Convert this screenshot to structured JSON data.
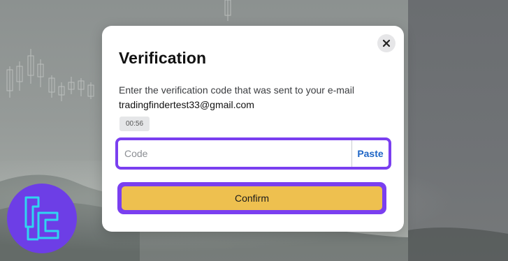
{
  "modal": {
    "title": "Verification",
    "instruction": "Enter the verification code that was sent to your e-mail",
    "email": "tradingfindertest33@gmail.com",
    "timer": "00:56",
    "code_placeholder": "Code",
    "code_value": "",
    "paste_label": "Paste",
    "confirm_label": "Confirm",
    "close_icon": "close-icon"
  },
  "logo": {
    "icon": "tf-logo-icon"
  },
  "colors": {
    "accent_purple": "#7a3ff0",
    "confirm_yellow": "#eec04f",
    "paste_blue": "#1f66c6",
    "logo_bg": "#6d3ee6",
    "logo_stroke": "#2fd6f0"
  }
}
